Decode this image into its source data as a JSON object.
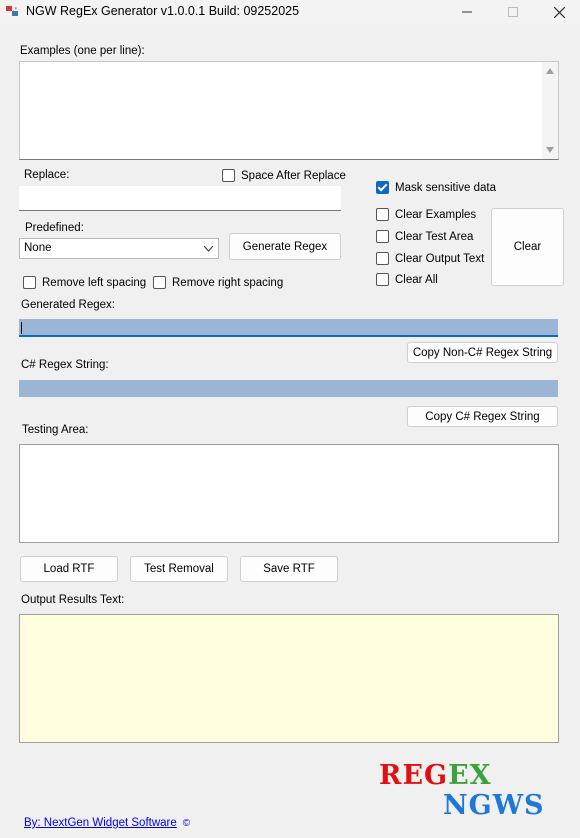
{
  "window": {
    "title": "NGW RegEx Generator v1.0.0.1 Build: 09252025",
    "minimize_icon": "minimize-icon",
    "maximize_icon": "maximize-icon",
    "close_icon": "close-icon"
  },
  "examples": {
    "label": "Examples (one per line):",
    "value": ""
  },
  "replace": {
    "label": "Replace:",
    "value": "",
    "space_after_label": "Space After Replace",
    "space_after_checked": false
  },
  "predefined": {
    "label": "Predefined:",
    "selected": "None"
  },
  "buttons": {
    "generate": "Generate Regex",
    "clear": "Clear",
    "copy_non_csharp": "Copy Non-C# Regex String",
    "copy_csharp": "Copy C# Regex String",
    "load_rtf": "Load RTF",
    "test_removal": "Test Removal",
    "save_rtf": "Save RTF"
  },
  "options": {
    "mask_sensitive": {
      "label": "Mask sensitive data",
      "checked": true
    },
    "clear_examples": {
      "label": "Clear Examples",
      "checked": false
    },
    "clear_test_area": {
      "label": "Clear Test Area",
      "checked": false
    },
    "clear_output_text": {
      "label": "Clear Output Text",
      "checked": false
    },
    "clear_all": {
      "label": "Clear All",
      "checked": false
    },
    "remove_left_spacing": {
      "label": "Remove left spacing",
      "checked": false
    },
    "remove_right_spacing": {
      "label": "Remove right spacing",
      "checked": false
    }
  },
  "generated_regex": {
    "label": "Generated Regex:",
    "value": ""
  },
  "csharp_regex": {
    "label": "C# Regex String:",
    "value": ""
  },
  "testing_area": {
    "label": "Testing Area:",
    "value": ""
  },
  "output_results": {
    "label": "Output Results Text:",
    "value": ""
  },
  "logo": {
    "line1": "REGEX",
    "line2": "NGWS"
  },
  "footer": {
    "link": "By: NextGen Widget Software",
    "symbol": "©"
  },
  "colors": {
    "accent": "#0f68c4",
    "regex_box": "#9bb5d5",
    "output_bg": "#ffffe0",
    "logo_red": "#e01010",
    "logo_green": "#3aa23a",
    "logo_blue": "#1e78d8"
  }
}
